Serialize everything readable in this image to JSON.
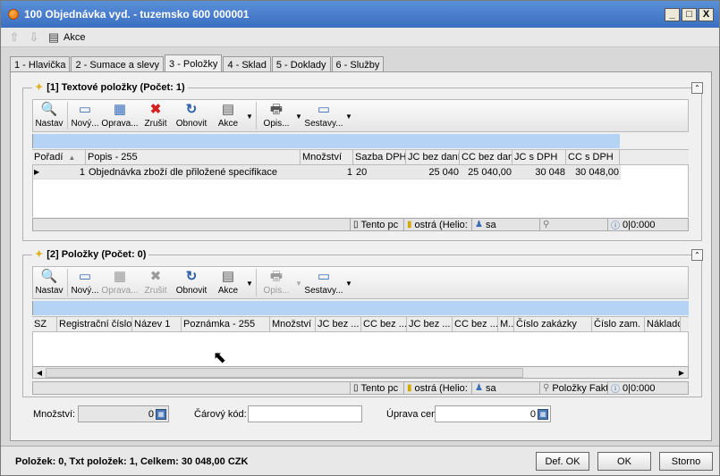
{
  "window": {
    "title": "100  Objednávka vyd. - tuzemsko  600 000001",
    "min": "_",
    "max": "□",
    "close": "X"
  },
  "menubar": {
    "akce": "Akce"
  },
  "tabs": [
    {
      "label": "1 - Hlavička"
    },
    {
      "label": "2 - Sumace a slevy"
    },
    {
      "label": "3 - Položky"
    },
    {
      "label": "4 - Sklad"
    },
    {
      "label": "5 - Doklady"
    },
    {
      "label": "6 - Služby"
    }
  ],
  "group1": {
    "title": "[1] Textové položky  (Počet: 1)",
    "toolbar": {
      "nastav": "Nastav",
      "novy": "Nový...",
      "oprava": "Oprava...",
      "zrusit": "Zrušit",
      "obnovit": "Obnovit",
      "akce": "Akce",
      "opis": "Opis...",
      "sestavy": "Sestavy..."
    },
    "columns": [
      "Pořadí",
      "Popis - 255",
      "Množství",
      "Sazba DPH",
      "JC bez daní",
      "CC bez daní",
      "JC s DPH",
      "CC s DPH"
    ],
    "rows": [
      {
        "poradi": "1",
        "popis": "Objednávka zboží dle přiložené specifikace",
        "mnozstvi": "1",
        "sazba": "20",
        "jc_bez": "25 040",
        "cc_bez": "25 040,00",
        "jc_s": "30 048",
        "cc_s": "30 048,00"
      }
    ],
    "status": {
      "tento": "Tento pc",
      "ostra": "ostrá (Helio:",
      "user": "sa",
      "info": "0|0:000"
    }
  },
  "group2": {
    "title": "[2] Položky  (Počet: 0)",
    "toolbar": {
      "nastav": "Nastav",
      "novy": "Nový...",
      "oprava": "Oprava...",
      "zrusit": "Zrušit",
      "obnovit": "Obnovit",
      "akce": "Akce",
      "opis": "Opis...",
      "sestavy": "Sestavy..."
    },
    "columns": [
      "SZ",
      "Registrační číslo",
      "Název 1",
      "Poznámka - 255",
      "Množství",
      "JC bez ...",
      "CC bez ...",
      "JC bez ...",
      "CC bez ...",
      "M...",
      "Číslo zakázky",
      "Číslo zam.",
      "Nákladc"
    ],
    "status": {
      "tento": "Tento pc",
      "ostra": "ostrá (Helio:",
      "user": "sa",
      "filter": "Položky Fakt",
      "info": "0|0:000"
    }
  },
  "fields": {
    "mnozstvi_label": "Množství:",
    "mnozstvi_value": "0",
    "carovy_label": "Čárový kód:",
    "carovy_value": "",
    "uprava_label": "Úprava cen (%):",
    "uprava_value": "0"
  },
  "footer": {
    "summary": "Položek: 0,  Txt položek: 1,  Celkem: 30 048,00 CZK",
    "def_ok": "Def. OK",
    "ok": "OK",
    "storno": "Storno"
  }
}
